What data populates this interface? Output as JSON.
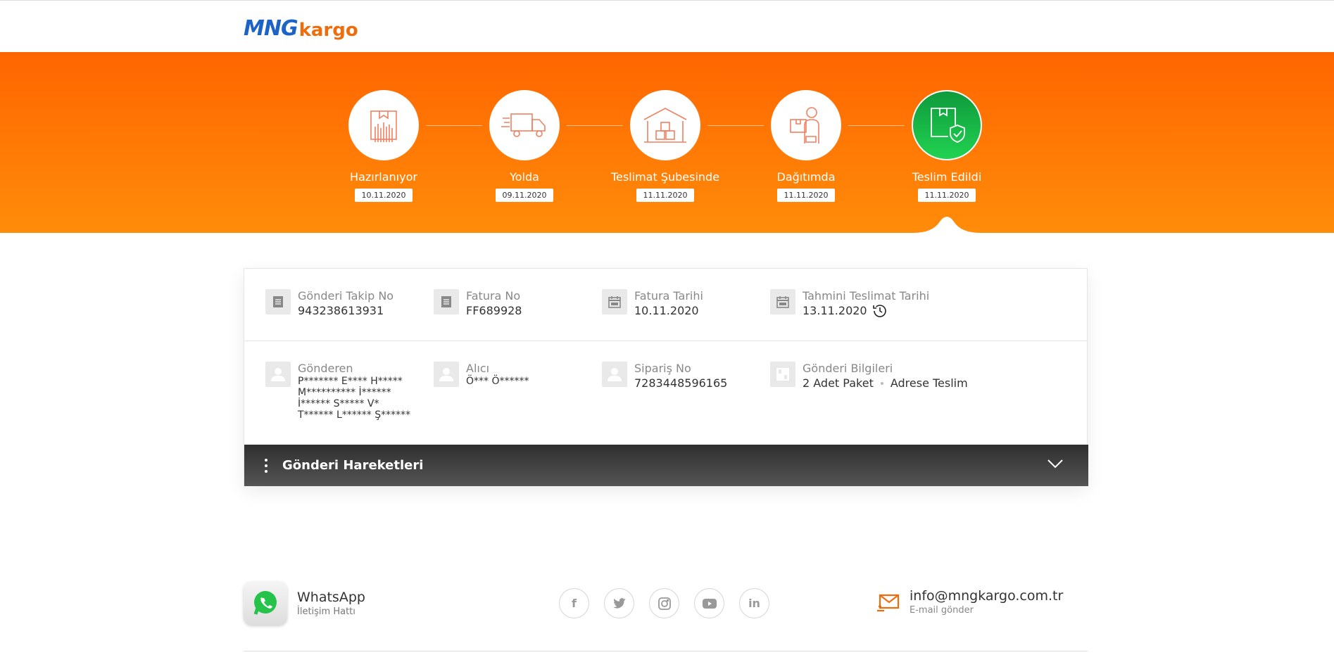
{
  "logo": {
    "part1": "MNG",
    "part2": "kargo"
  },
  "steps": [
    {
      "label": "Hazırlanıyor",
      "date": "10.11.2020",
      "icon": "package-scan-icon"
    },
    {
      "label": "Yolda",
      "date": "09.11.2020",
      "icon": "truck-icon"
    },
    {
      "label": "Teslimat Şubesinde",
      "date": "11.11.2020",
      "icon": "warehouse-icon"
    },
    {
      "label": "Dağıtımda",
      "date": "11.11.2020",
      "icon": "courier-icon"
    },
    {
      "label": "Teslim Edildi",
      "date": "11.11.2020",
      "icon": "delivered-package-icon",
      "status_color": "#1fc04a"
    }
  ],
  "details": {
    "tracking": {
      "title": "Gönderi Takip No",
      "value": "943238613931"
    },
    "invoice": {
      "title": "Fatura No",
      "value": "FF689928"
    },
    "invoice_date": {
      "title": "Fatura Tarihi",
      "value": "10.11.2020"
    },
    "estimated": {
      "title": "Tahmini Teslimat Tarihi",
      "value": "13.11.2020"
    },
    "sender": {
      "title": "Gönderen",
      "lines": [
        "P******* E**** H*****",
        "M********** İ******",
        "İ****** S***** V*",
        "T****** L****** Ş******"
      ]
    },
    "receiver": {
      "title": "Alıcı",
      "value": "Ö*** Ö******"
    },
    "order": {
      "title": "Sipariş No",
      "value": "7283448596165"
    },
    "shipment": {
      "title": "Gönderi Bilgileri",
      "value1": "2 Adet Paket",
      "value2": "Adrese Teslim"
    }
  },
  "movements": {
    "title": "Gönderi Hareketleri"
  },
  "footer": {
    "whatsapp_title": "WhatsApp",
    "whatsapp_sub": "İletişim Hattı",
    "socials": [
      {
        "name": "facebook-icon",
        "glyph": "f"
      },
      {
        "name": "twitter-icon",
        "glyph": "t"
      },
      {
        "name": "instagram-icon",
        "glyph": "◎"
      },
      {
        "name": "youtube-icon",
        "glyph": "▶"
      },
      {
        "name": "linkedin-icon",
        "glyph": "in"
      }
    ],
    "email": "info@mngkargo.com.tr",
    "email_sub": "E-mail gönder"
  },
  "colors": {
    "brand_orange": "#ff7a00",
    "brand_blue": "#1d63c6",
    "delivered_green": "#1fc04a"
  }
}
